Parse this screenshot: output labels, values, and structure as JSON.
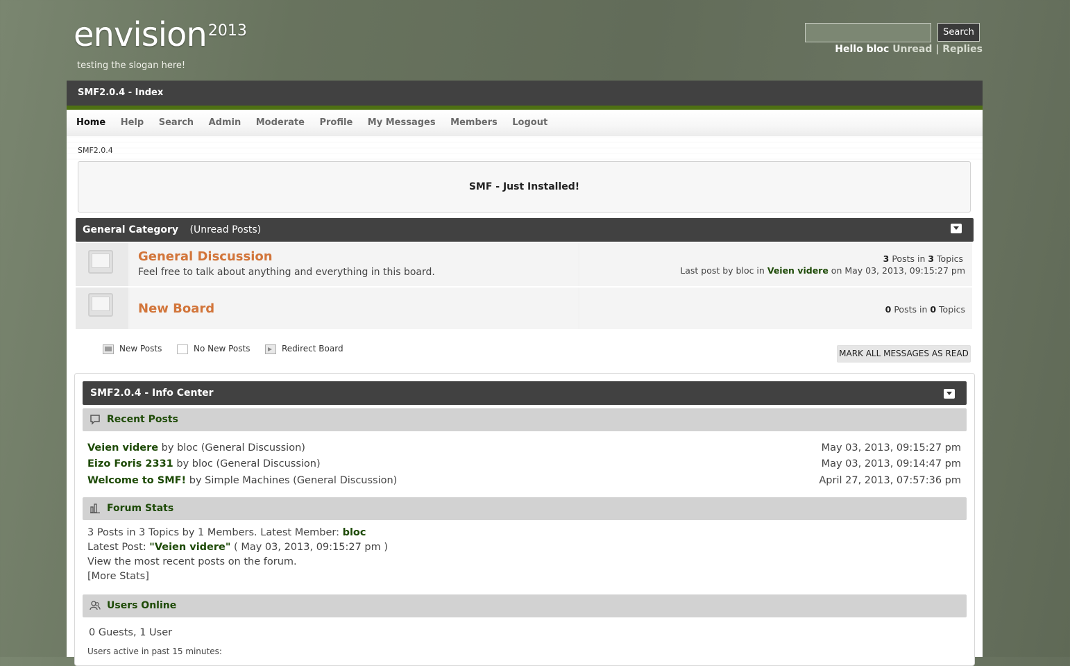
{
  "header": {
    "logo_text": "envision",
    "logo_year": "2013",
    "slogan": "testing the slogan here!",
    "search_placeholder": "",
    "search_button": "Search",
    "hello": "Hello bloc",
    "unread": "Unread",
    "separator": "|",
    "replies": "Replies"
  },
  "topbar": {
    "title": "SMF2.0.4 - Index"
  },
  "nav": {
    "items": [
      "Home",
      "Help",
      "Search",
      "Admin",
      "Moderate",
      "Profile",
      "My Messages",
      "Members",
      "Logout"
    ],
    "active": "Home"
  },
  "breadcrumb": "SMF2.0.4",
  "announcement": "SMF - Just Installed!",
  "category": {
    "name": "General Category",
    "unread_link": "(Unread Posts)"
  },
  "boards": [
    {
      "title": "General Discussion",
      "description": "Feel free to talk about anything and everything in this board.",
      "posts": "3",
      "posts_label": "Posts in",
      "topics": "3",
      "topics_label": "Topics",
      "last_post_prefix": "Last post by bloc in",
      "last_post_topic": "Veien videre",
      "last_post_suffix": "on May 03, 2013, 09:15:27 pm"
    },
    {
      "title": "New Board",
      "description": "",
      "posts": "0",
      "posts_label": "Posts in",
      "topics": "0",
      "topics_label": "Topics"
    }
  ],
  "legend": {
    "new_posts": "New Posts",
    "no_new_posts": "No New Posts",
    "redirect": "Redirect Board"
  },
  "mark_all": "MARK ALL MESSAGES AS READ",
  "info_center": {
    "title": "SMF2.0.4 - Info Center",
    "recent_posts_title": "Recent Posts",
    "recent_posts": [
      {
        "topic": "Veien videre",
        "by": "by bloc (General Discussion)",
        "date": "May 03, 2013, 09:15:27 pm"
      },
      {
        "topic": "Eizo Foris 2331",
        "by": "by bloc (General Discussion)",
        "date": "May 03, 2013, 09:14:47 pm"
      },
      {
        "topic": "Welcome to SMF!",
        "by": "by Simple Machines (General Discussion)",
        "date": "April 27, 2013, 07:57:36 pm"
      }
    ],
    "forum_stats_title": "Forum Stats",
    "stats_line1": "3 Posts in 3 Topics by 1 Members. Latest Member:",
    "stats_latest_member": "bloc",
    "stats_line2_prefix": "Latest Post:",
    "stats_latest_post": "\"Veien videre\"",
    "stats_line2_suffix": "( May 03, 2013, 09:15:27 pm )",
    "stats_line3": "View the most recent posts on the forum.",
    "stats_more": "[More Stats]",
    "users_online_title": "Users Online",
    "users_online_count": "0 Guests, 1 User",
    "users_active": "Users active in past 15 minutes:"
  },
  "colors": {
    "accent_green": "#4e7013",
    "link_green": "#1d4a06",
    "board_orange": "#d2753a",
    "bar_dark": "#414141"
  }
}
